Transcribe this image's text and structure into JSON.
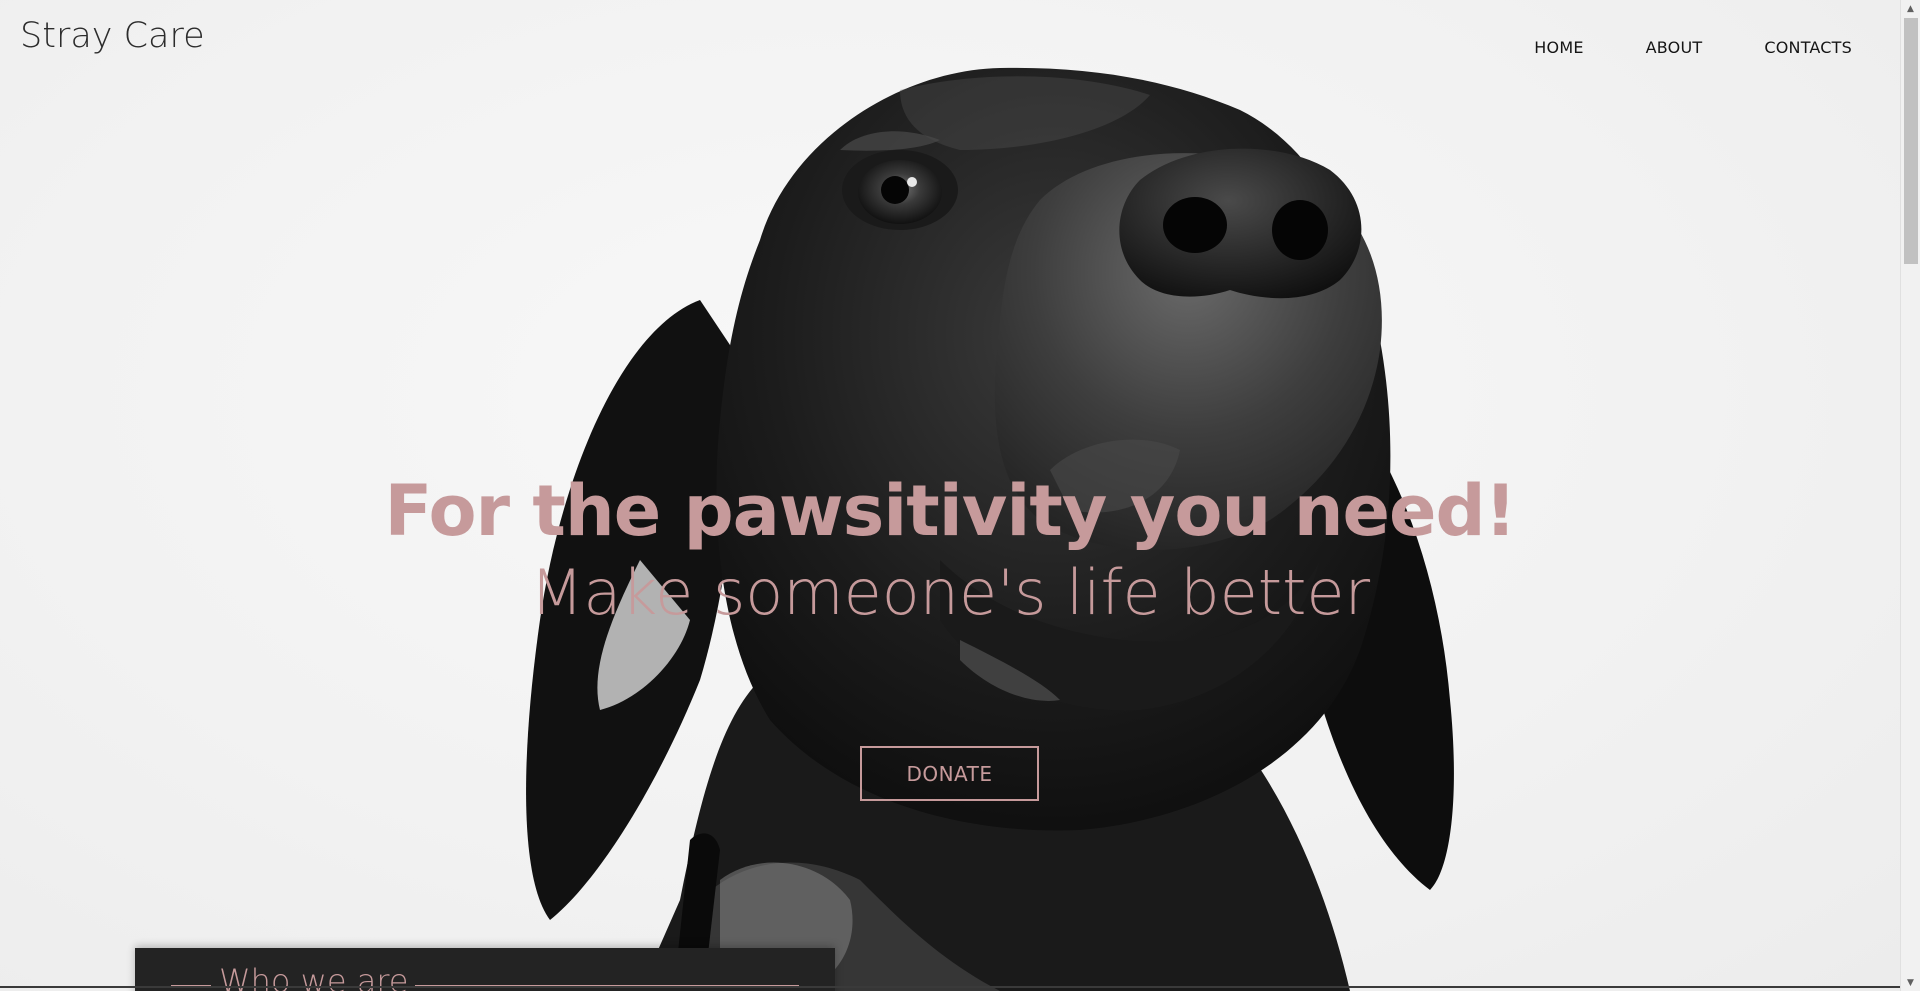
{
  "brand": {
    "name": "Stray Care"
  },
  "nav": {
    "items": [
      {
        "label": "HOME"
      },
      {
        "label": "ABOUT"
      },
      {
        "label": "CONTACTS"
      }
    ]
  },
  "hero": {
    "headline": "For the pawsitivity you need!",
    "subheadline": "Make someone's life better",
    "cta_label": "DONATE",
    "accent_color": "#c69a9b"
  },
  "about": {
    "title": "Who we are"
  },
  "scrollbar": {
    "up_icon": "▲",
    "down_icon": "▼",
    "position": 0.0
  }
}
